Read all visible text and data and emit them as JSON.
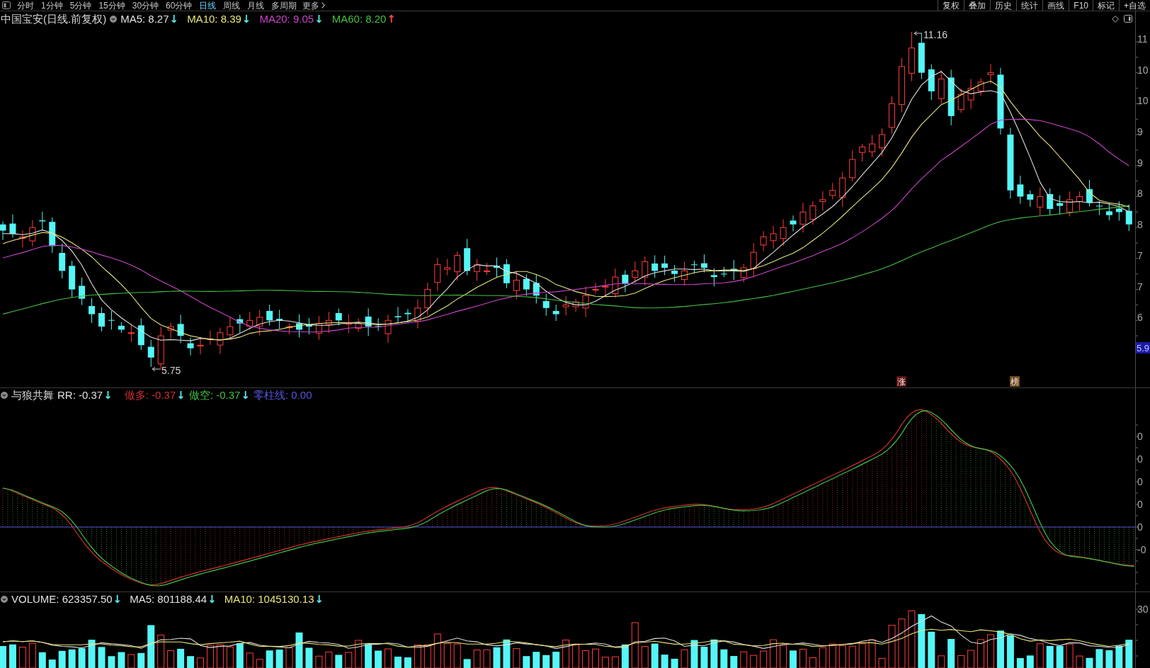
{
  "toolbar": {
    "periods": [
      {
        "label": "分时",
        "selected": false
      },
      {
        "label": "1分钟",
        "selected": false
      },
      {
        "label": "5分钟",
        "selected": false
      },
      {
        "label": "15分钟",
        "selected": false
      },
      {
        "label": "30分钟",
        "selected": false
      },
      {
        "label": "60分钟",
        "selected": false
      },
      {
        "label": "日线",
        "selected": true
      },
      {
        "label": "周线",
        "selected": false
      },
      {
        "label": "月线",
        "selected": false
      },
      {
        "label": "多周期",
        "selected": false
      }
    ],
    "more": "更多",
    "actions": [
      "复权",
      "叠加",
      "历史",
      "统计",
      "画线",
      "F10",
      "标记",
      "+自选"
    ]
  },
  "price_panel": {
    "title": "中国宝安(日线.前复权)",
    "averages": [
      {
        "label": "MA5: 8.27",
        "arrow": {
          "glyph": "↓",
          "color": "#50eef0"
        },
        "color": "#e0e0e0"
      },
      {
        "label": "MA10: 8.39",
        "arrow": {
          "glyph": "↓",
          "color": "#50eef0"
        },
        "color": "#e8e47a"
      },
      {
        "label": "MA20: 9.05",
        "arrow": {
          "glyph": "↓",
          "color": "#50eef0"
        },
        "color": "#cc44cc"
      },
      {
        "label": "MA60: 8.20",
        "arrow": {
          "glyph": "↑",
          "color": "#ff4a4a"
        },
        "color": "#44c044"
      }
    ],
    "high_label": "11.16",
    "low_label": "5.75",
    "markers": [
      {
        "label": "涨",
        "color": "#5c1414"
      },
      {
        "label": "榜",
        "color": "#6e4c22"
      }
    ],
    "axis_labels": [
      "11",
      "10",
      "10",
      "9",
      "9",
      "8",
      "8",
      "7",
      "7",
      "6"
    ],
    "current_value": "5.9"
  },
  "indicator_panel": {
    "name": "与狼共舞",
    "readings": [
      {
        "label": "RR: -0.37",
        "arrow": {
          "glyph": "↓",
          "color": "#50eef0"
        },
        "color": "#e0e0e0"
      },
      {
        "label": "做多: -0.37",
        "arrow": {
          "glyph": "↓",
          "color": "#50eef0"
        },
        "color": "#d03030"
      },
      {
        "label": "做空: -0.37",
        "arrow": {
          "glyph": "↓",
          "color": "#50eef0"
        },
        "color": "#40c040"
      },
      {
        "label": "零柱线: 0.00",
        "color": "#5656dc"
      }
    ],
    "axis_labels": [
      "0",
      "0",
      "0",
      "0",
      "0",
      "-0"
    ]
  },
  "volume_panel": {
    "readings": [
      {
        "label": "VOLUME: 623357.50",
        "arrow": {
          "glyph": "↓",
          "color": "#50eef0"
        },
        "color": "#e0e0e0"
      },
      {
        "label": "MA5: 801188.44",
        "arrow": {
          "glyph": "↓",
          "color": "#50eef0"
        },
        "color": "#e0e0e0"
      },
      {
        "label": "MA10: 1045130.13",
        "arrow": {
          "glyph": "↓",
          "color": "#50eef0"
        },
        "color": "#e8e47a"
      }
    ],
    "axis_labels": [
      "30"
    ]
  }
}
